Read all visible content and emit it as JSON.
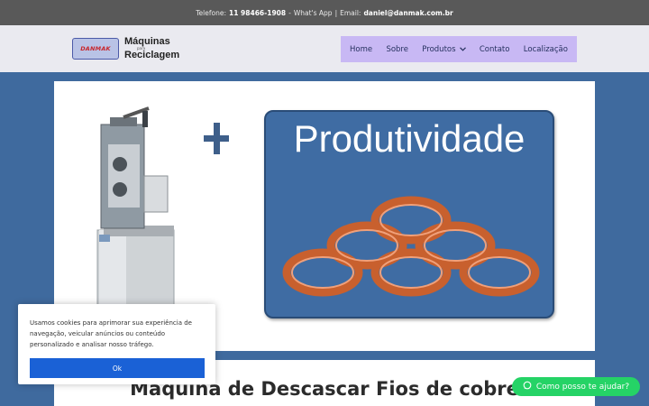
{
  "topbar": {
    "phone_label": "Telefone:",
    "phone": "11 98466-1908",
    "sep1": "-",
    "whatsapp": "What's App",
    "sep2": "|",
    "email_label": "Email:",
    "email": "daniel@danmak.com.br"
  },
  "logo": {
    "badge": "DANMAK",
    "line1": "Máquinas",
    "small": "para",
    "line2": "Reciclagem"
  },
  "nav": {
    "items": [
      "Home",
      "Sobre",
      "Produtos",
      "Contato",
      "Localização"
    ],
    "dropdown_icon": "chevron-down-icon"
  },
  "hero": {
    "plus": "+",
    "title": "Produtividade"
  },
  "section": {
    "title": "Máquina de Descascar Fios de cobre"
  },
  "cookie": {
    "text": "Usamos cookies para aprimorar sua experiência de navegação, veicular anúncios ou conteúdo personalizado e analisar nosso tráfego.",
    "button": "Ok"
  },
  "whatsapp": {
    "label": "Como posso te ajudar?",
    "icon": "whatsapp-icon"
  },
  "colors": {
    "page_bg": "#3f6a9e",
    "topbar_bg": "#595959",
    "nav_bg": "#c8b8f4",
    "cookie_button": "#1a61d6",
    "whatsapp": "#25d366"
  }
}
